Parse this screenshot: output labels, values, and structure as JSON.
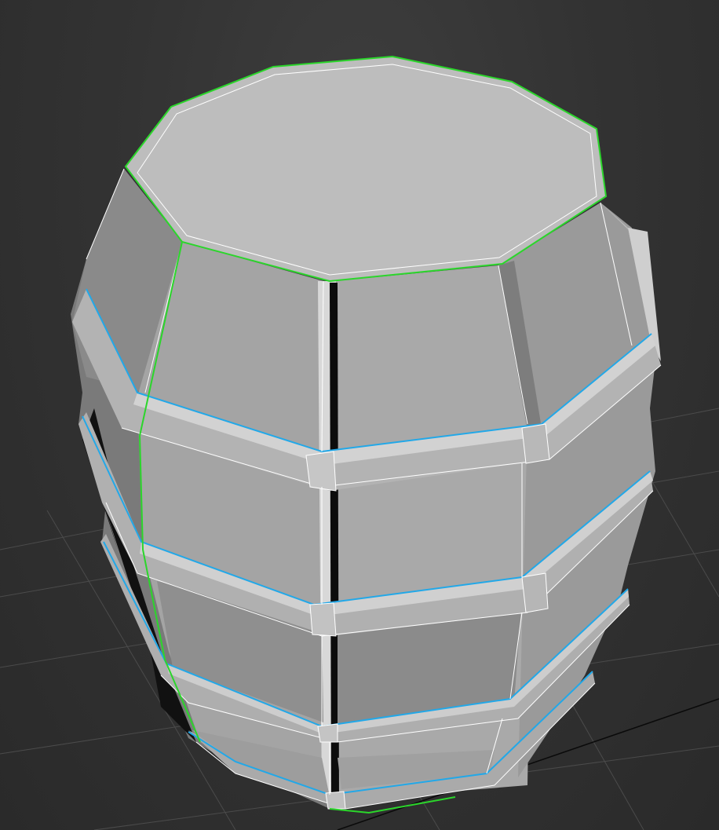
{
  "viewport": {
    "background_color": "#353535",
    "grid_color": "#4a4a4a",
    "object": "barrel-mesh",
    "selection_colors": {
      "selected_edge_loop": "#2bd62b",
      "highlighted_edge_loop": "#22a8e8",
      "wire_edges": "#ffffff"
    },
    "shading": {
      "top_face": "#bdbdbd",
      "stave_light": "#a8a8a8",
      "stave_mid": "#8f8f8f",
      "stave_dark": "#6f6f6f",
      "hoop_light": "#c9c9c9",
      "hoop_mid": "#b0b0b0",
      "hoop_dark": "#8a8a8a"
    }
  }
}
